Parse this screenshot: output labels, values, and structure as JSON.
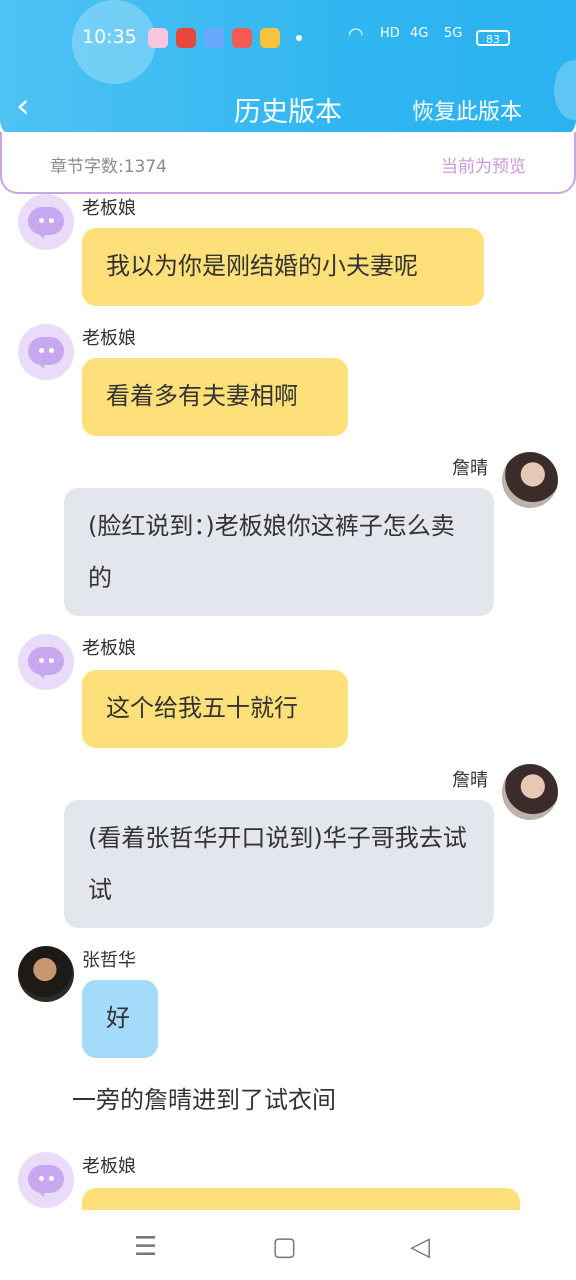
{
  "status_bar": {
    "time": "10:35",
    "network_1": "4G",
    "network_2": "5G",
    "hd": "HD",
    "battery": "83"
  },
  "header": {
    "title": "历史版本",
    "restore_label": "恢复此版本",
    "back_icon": "chevron-left-icon"
  },
  "info": {
    "word_count": "章节字数:1374",
    "preview_status": "当前为预览"
  },
  "messages": [
    {
      "speaker": "老板娘",
      "text": "我以为你是刚结婚的小夫妻呢"
    },
    {
      "speaker": "老板娘",
      "text": "看着多有夫妻相啊"
    },
    {
      "speaker": "詹晴",
      "text": "(脸红说到：)老板娘你这裤子怎么卖的"
    },
    {
      "speaker": "老板娘",
      "text": "这个给我五十就行"
    },
    {
      "speaker": "詹晴",
      "text": "(看着张哲华开口说到)华子哥我去试试"
    },
    {
      "speaker": "张哲华",
      "text": "好"
    },
    {
      "speaker": "",
      "text": "一旁的詹晴进到了试衣间"
    },
    {
      "speaker": "老板娘",
      "text": ""
    }
  ],
  "colors": {
    "header": "#31b6f1",
    "bubble_boss": "#fde07a",
    "bubble_self": "#e3e6ec",
    "bubble_zhang": "#a4dafa",
    "info_border": "#c9a5e6",
    "preview_text": "#c99ad9"
  },
  "system_nav": {
    "menu_icon": "menu-icon",
    "home_icon": "home-square-icon",
    "back_icon": "back-triangle-icon"
  }
}
